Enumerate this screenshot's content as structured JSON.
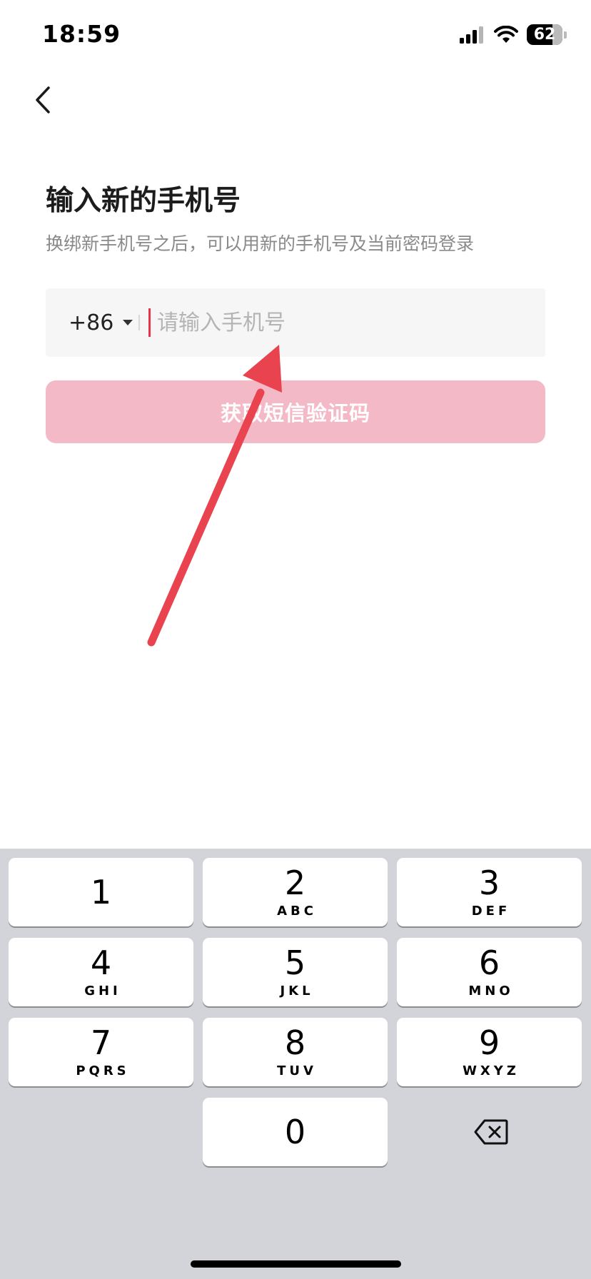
{
  "status_bar": {
    "time": "18:59",
    "battery": "62",
    "icons": [
      "signal-icon",
      "wifi-icon",
      "battery-icon"
    ]
  },
  "nav": {
    "back_icon": "chevron-left-icon"
  },
  "page": {
    "title": "输入新的手机号",
    "subtitle": "换绑新手机号之后，可以用新的手机号及当前密码登录"
  },
  "phone_field": {
    "country_code": "+86",
    "dropdown_icon": "triangle-down-icon",
    "value": "",
    "placeholder": "请输入手机号"
  },
  "sms_button": {
    "label": "获取短信验证码",
    "enabled": false
  },
  "colors": {
    "accent": "#e8334a",
    "button_disabled": "#f4b9c6",
    "annotation_arrow": "#e8434f",
    "keyboard_bg": "#d2d4d9"
  },
  "keyboard": {
    "keys": [
      {
        "digit": "1",
        "letters": ""
      },
      {
        "digit": "2",
        "letters": "ABC"
      },
      {
        "digit": "3",
        "letters": "DEF"
      },
      {
        "digit": "4",
        "letters": "GHI"
      },
      {
        "digit": "5",
        "letters": "JKL"
      },
      {
        "digit": "6",
        "letters": "MNO"
      },
      {
        "digit": "7",
        "letters": "PQRS"
      },
      {
        "digit": "8",
        "letters": "TUV"
      },
      {
        "digit": "9",
        "letters": "WXYZ"
      },
      {
        "digit": "0",
        "letters": ""
      }
    ],
    "backspace_icon": "backspace-icon"
  }
}
